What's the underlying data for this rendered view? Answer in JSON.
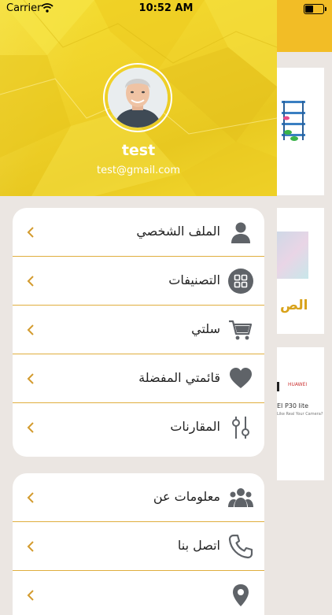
{
  "status_bar": {
    "carrier": "Carrier",
    "time": "10:52 AM",
    "battery_level": 0.5
  },
  "drawer": {
    "user": {
      "name": "test",
      "email": "test@gmail.com"
    },
    "primary_menu": [
      {
        "label": "الملف الشخصي",
        "icon": "user-icon"
      },
      {
        "label": "التصنيفات",
        "icon": "grid-icon"
      },
      {
        "label": "سلتي",
        "icon": "cart-icon"
      },
      {
        "label": "قائمتي المفضلة",
        "icon": "heart-icon"
      },
      {
        "label": "المقارنات",
        "icon": "sliders-icon"
      }
    ],
    "secondary_menu": [
      {
        "label": "معلومات عن",
        "icon": "group-icon"
      },
      {
        "label": "اتصل بنا",
        "icon": "phone-icon"
      },
      {
        "label": "",
        "icon": "location-icon"
      }
    ]
  },
  "background": {
    "card2_text": "الص",
    "card3_brand": "HUAWEI",
    "card3_model": "EI P30 lite",
    "card3_tagline": "Like Real Your Camera?"
  },
  "colors": {
    "accent": "#e0ae3e",
    "header_yellow": "#f0d22a",
    "app_bar": "#f2bd26",
    "icon_gray": "#5f6368"
  }
}
